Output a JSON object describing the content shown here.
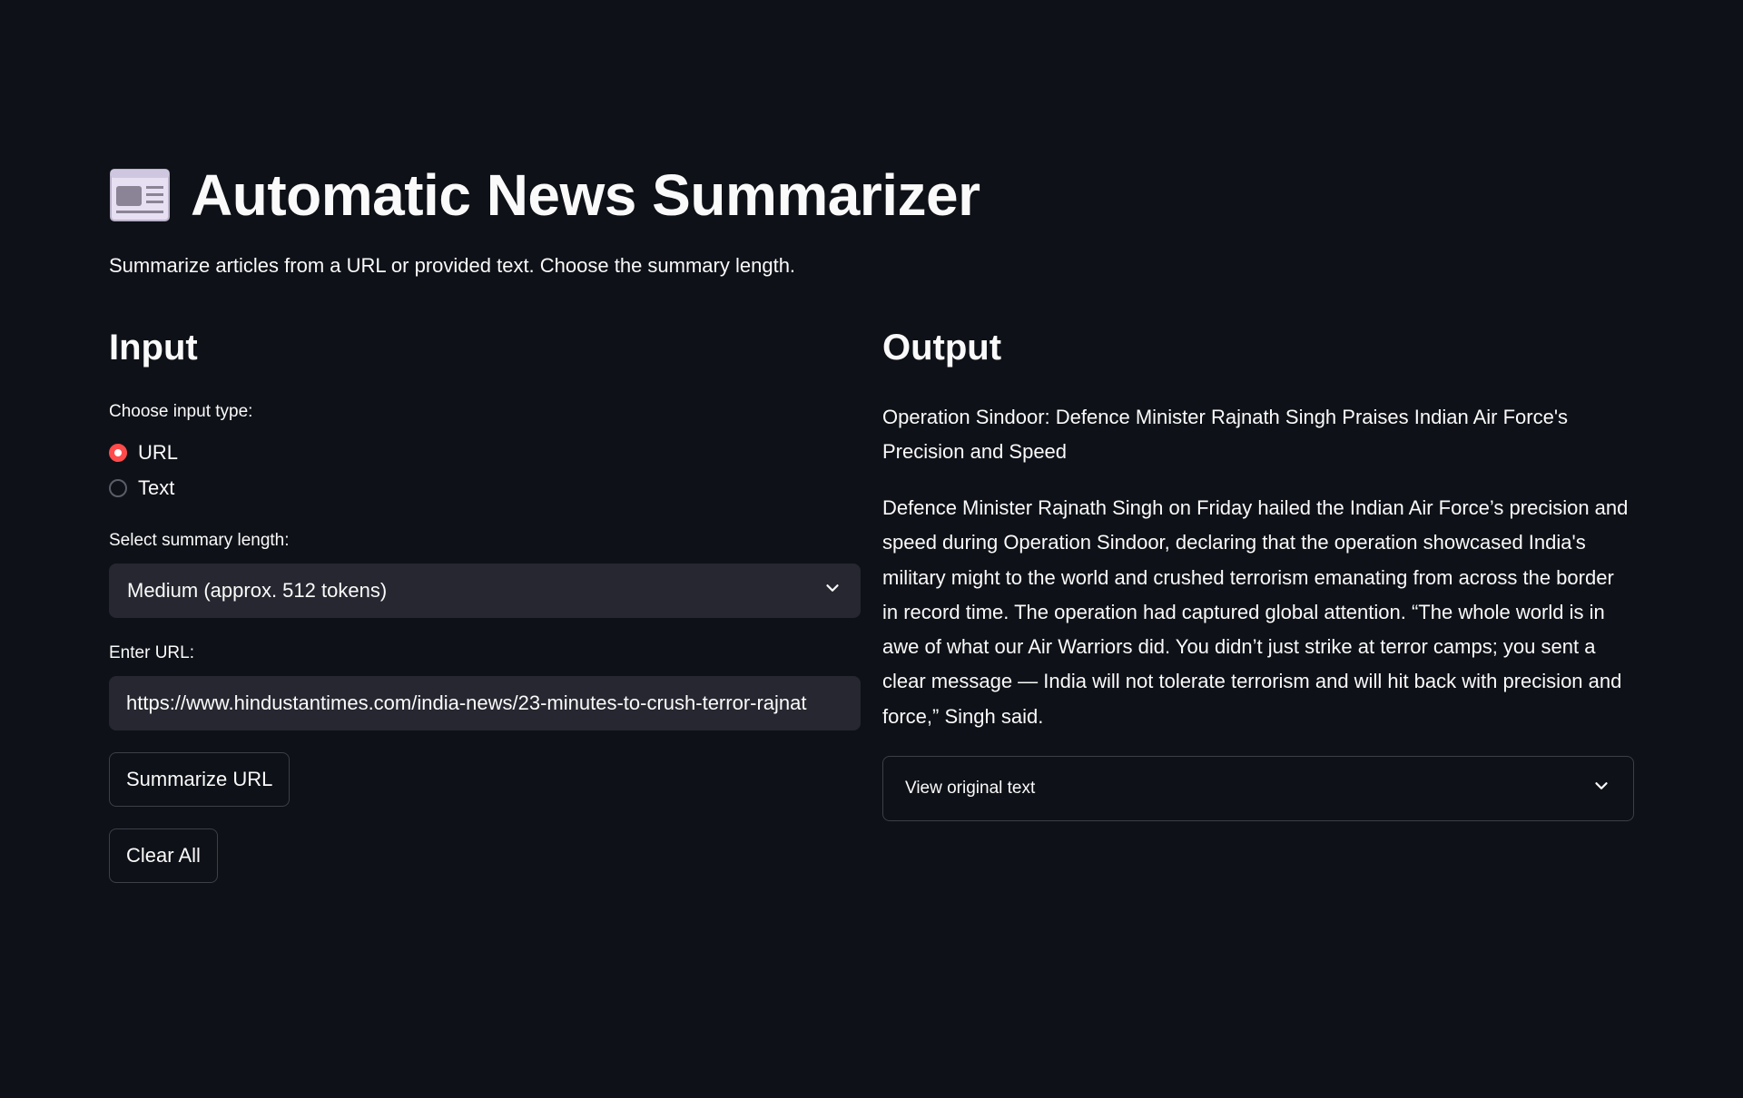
{
  "header": {
    "title": "Automatic News Summarizer",
    "subtitle": "Summarize articles from a URL or provided text. Choose the summary length.",
    "icon": "newspaper-icon"
  },
  "input": {
    "heading": "Input",
    "input_type_label": "Choose input type:",
    "input_type_options": [
      "URL",
      "Text"
    ],
    "input_type_selected": "URL",
    "summary_length_label": "Select summary length:",
    "summary_length_selected": "Medium (approx. 512 tokens)",
    "url_label": "Enter URL:",
    "url_value": "https://www.hindustantimes.com/india-news/23-minutes-to-crush-terror-rajnat",
    "summarize_button": "Summarize URL",
    "clear_button": "Clear All"
  },
  "output": {
    "heading": "Output",
    "article_title": "Operation Sindoor: Defence Minister Rajnath Singh Praises Indian Air Force's Precision and Speed",
    "summary": "Defence Minister Rajnath Singh on Friday hailed the Indian Air Force’s precision and speed during Operation Sindoor, declaring that the operation showcased India's military might to the world and crushed terrorism emanating from across the border in record time. The operation had captured global attention. “The whole world is in awe of what our Air Warriors did. You didn’t just strike at terror camps; you sent a clear message — India will not tolerate terrorism and will hit back with precision and force,” Singh said.",
    "expander_label": "View original text"
  },
  "colors": {
    "background": "#0e1117",
    "widget_bg": "#262730",
    "accent": "#ff4b4b",
    "text": "#fafafa"
  }
}
